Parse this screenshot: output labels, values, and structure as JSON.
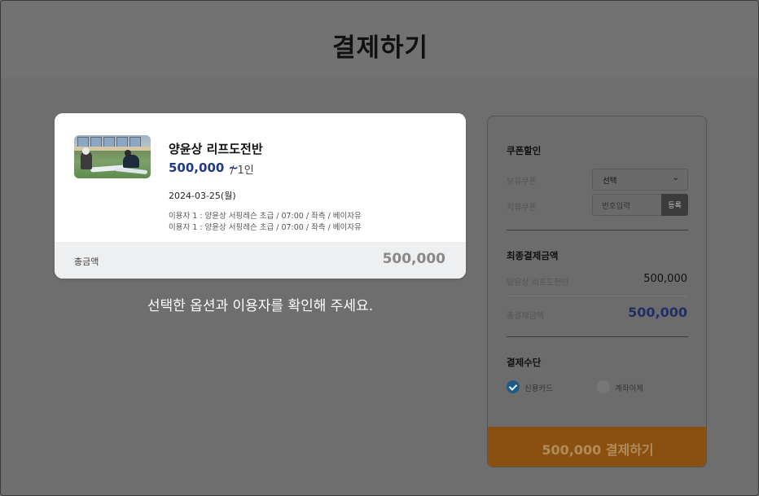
{
  "header": {
    "title": "결제하기"
  },
  "product": {
    "title": "양윤상 리프도전반",
    "price": "500,000 ~",
    "unit": "/ 1인",
    "date": "2024-03-25(월)",
    "participants": [
      "이용자 1 : 양윤상 서핑레슨 초급 / 07:00 / 좌측 / 베이자유",
      "이용자 1 : 양윤상 서핑레슨 초급 / 07:00 / 좌측 / 베이자유"
    ],
    "total_label": "총금액",
    "total_value": "500,000"
  },
  "note": "선택한 옵션과 이용자를 확인해 주세요.",
  "coupon": {
    "title": "쿠폰할인",
    "owned_label": "보유쿠폰",
    "select_value": "선택",
    "paper_label": "지류쿠폰",
    "input_placeholder": "번호입력",
    "register_label": "등록"
  },
  "final": {
    "title": "최종결제금액",
    "item_label": "양윤상 리프도전반",
    "item_value": "500,000",
    "total_label": "총결제금액",
    "total_value": "500,000"
  },
  "method": {
    "title": "결제수단",
    "options": [
      {
        "label": "신용카드",
        "selected": true
      },
      {
        "label": "계좌이체",
        "selected": false
      }
    ]
  },
  "pay_button": "500,000 결제하기",
  "colors": {
    "overlay": "#6e6e6e",
    "price_blue": "#1f3a8a",
    "pay_button": "#8a5010",
    "radio_selected": "#1d5b86"
  }
}
